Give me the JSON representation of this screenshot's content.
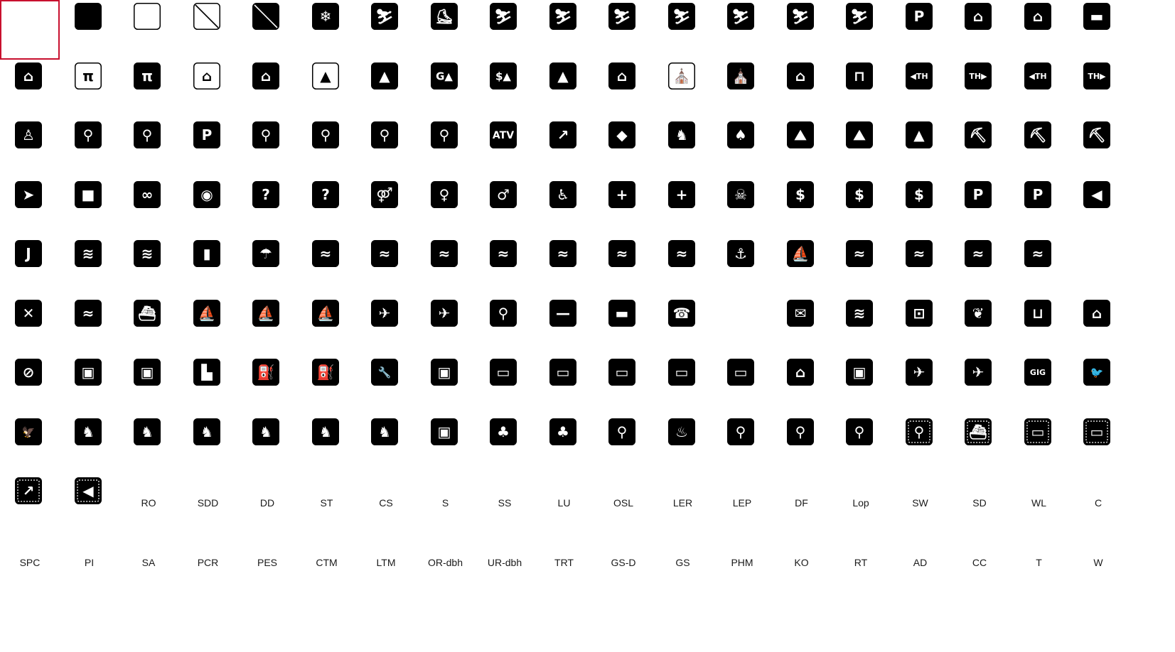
{
  "colors": {
    "symbol": "#000000",
    "symbol_fg": "#ffffff",
    "selection": "#c8102e",
    "label": "#1a1a1a"
  },
  "palette": {
    "columns": 19,
    "selected_index": 0,
    "items": [
      {
        "kind": "blank",
        "icon": "blank-selected"
      },
      {
        "kind": "solid",
        "icon": "solid-black-square"
      },
      {
        "kind": "outline",
        "icon": "outline-square"
      },
      {
        "kind": "slash-outline",
        "icon": "prohibition-outline-square"
      },
      {
        "kind": "slash-solid",
        "icon": "prohibition-solid-square"
      },
      {
        "kind": "glyph",
        "icon": "snowflake-icon",
        "glyph": "❄"
      },
      {
        "kind": "glyph",
        "icon": "snowshoeing-icon",
        "glyph": "⛷"
      },
      {
        "kind": "glyph",
        "icon": "ice-skating-icon",
        "glyph": "⛸"
      },
      {
        "kind": "glyph",
        "icon": "cross-country-ski-icon",
        "glyph": "⛷"
      },
      {
        "kind": "glyph",
        "icon": "snowmobile-icon",
        "glyph": "⛷"
      },
      {
        "kind": "glyph",
        "icon": "downhill-ski-icon",
        "glyph": "⛷"
      },
      {
        "kind": "glyph",
        "icon": "ski-jump-icon",
        "glyph": "⛷"
      },
      {
        "kind": "glyph",
        "icon": "sledding-icon",
        "glyph": "⛷"
      },
      {
        "kind": "glyph",
        "icon": "tobogganing-icon",
        "glyph": "⛷"
      },
      {
        "kind": "glyph",
        "icon": "snowmobile-trail-icon",
        "glyph": "⛷"
      },
      {
        "kind": "glyph",
        "icon": "snowmobile-parking-icon",
        "glyph": "P"
      },
      {
        "kind": "glyph",
        "icon": "shelter-icon",
        "glyph": "⌂"
      },
      {
        "kind": "glyph",
        "icon": "lodge-icon",
        "glyph": "⌂"
      },
      {
        "kind": "glyph",
        "icon": "bed-icon",
        "glyph": "▬"
      },
      {
        "kind": "glyph",
        "icon": "picnic-shelter-icon",
        "glyph": "⌂"
      },
      {
        "kind": "glyph-outline",
        "icon": "picnic-table-outline-icon",
        "glyph": "π"
      },
      {
        "kind": "glyph",
        "icon": "picnic-table-icon",
        "glyph": "π"
      },
      {
        "kind": "glyph-outline",
        "icon": "trailer-site-outline-icon",
        "glyph": "⌂"
      },
      {
        "kind": "glyph",
        "icon": "trailer-site-icon",
        "glyph": "⌂"
      },
      {
        "kind": "glyph-outline",
        "icon": "campground-outline-icon",
        "glyph": "▲"
      },
      {
        "kind": "glyph",
        "icon": "campground-icon",
        "glyph": "▲"
      },
      {
        "kind": "glyph",
        "icon": "group-camping-icon",
        "glyph": "G▲"
      },
      {
        "kind": "glyph",
        "icon": "paid-camping-icon",
        "glyph": "$▲"
      },
      {
        "kind": "glyph",
        "icon": "tent-icon",
        "glyph": "▲"
      },
      {
        "kind": "glyph",
        "icon": "cabin-icon",
        "glyph": "⌂"
      },
      {
        "kind": "glyph-outline",
        "icon": "chapel-outline-icon",
        "glyph": "⛪"
      },
      {
        "kind": "glyph",
        "icon": "chapel-icon",
        "glyph": "⛪"
      },
      {
        "kind": "glyph",
        "icon": "ranger-station-icon",
        "glyph": "⌂"
      },
      {
        "kind": "glyph",
        "icon": "lookout-tower-icon",
        "glyph": "⊓"
      },
      {
        "kind": "glyph",
        "icon": "trailhead-left-icon",
        "glyph": "◀TH"
      },
      {
        "kind": "glyph",
        "icon": "trailhead-right-icon",
        "glyph": "TH▶"
      },
      {
        "kind": "glyph",
        "icon": "trailhead-left-bold-icon",
        "glyph": "◀TH"
      },
      {
        "kind": "glyph",
        "icon": "trailhead-right-bold-icon",
        "glyph": "TH▶"
      },
      {
        "kind": "glyph",
        "icon": "hiking-icon",
        "glyph": "♙"
      },
      {
        "kind": "glyph",
        "icon": "bicycle-icon",
        "glyph": "⚲"
      },
      {
        "kind": "glyph",
        "icon": "mountain-bike-icon",
        "glyph": "⚲"
      },
      {
        "kind": "glyph",
        "icon": "motorbike-parking-icon",
        "glyph": "P"
      },
      {
        "kind": "glyph",
        "icon": "motorbike-icon",
        "glyph": "⚲"
      },
      {
        "kind": "glyph",
        "icon": "atv-icon",
        "glyph": "⚲"
      },
      {
        "kind": "glyph",
        "icon": "atv-rider-icon",
        "glyph": "⚲"
      },
      {
        "kind": "glyph",
        "icon": "atv-vehicle-icon",
        "glyph": "⚲"
      },
      {
        "kind": "text",
        "icon": "atv-text-icon",
        "glyph": "ATV"
      },
      {
        "kind": "glyph",
        "icon": "point-of-interest-icon",
        "glyph": "↗"
      },
      {
        "kind": "glyph",
        "icon": "bear-icon",
        "glyph": "◆"
      },
      {
        "kind": "glyph",
        "icon": "deer-icon",
        "glyph": "♞"
      },
      {
        "kind": "glyph",
        "icon": "squirrel-icon",
        "glyph": "♠"
      },
      {
        "kind": "glyph",
        "icon": "rock-climbing-icon",
        "glyph": "⛰"
      },
      {
        "kind": "glyph",
        "icon": "climbing-icon",
        "glyph": "⛰"
      },
      {
        "kind": "glyph",
        "icon": "rock-collecting-icon",
        "glyph": "▲"
      },
      {
        "kind": "glyph",
        "icon": "mine-cart-icon",
        "glyph": "⛏"
      },
      {
        "kind": "glyph",
        "icon": "pickaxe-icon",
        "glyph": "⛏"
      },
      {
        "kind": "glyph",
        "icon": "crawling-icon",
        "glyph": "⛏"
      },
      {
        "kind": "glyph",
        "icon": "fish-arrow-icon",
        "glyph": "➤"
      },
      {
        "kind": "glyph",
        "icon": "square-target-icon",
        "glyph": "■"
      },
      {
        "kind": "glyph",
        "icon": "binoculars-icon",
        "glyph": "∞"
      },
      {
        "kind": "glyph",
        "icon": "camera-icon",
        "glyph": "◉"
      },
      {
        "kind": "glyph",
        "icon": "information-icon",
        "glyph": "?"
      },
      {
        "kind": "glyph",
        "icon": "info-house-icon",
        "glyph": "?"
      },
      {
        "kind": "glyph",
        "icon": "restrooms-icon",
        "glyph": "⚤"
      },
      {
        "kind": "glyph",
        "icon": "women-restroom-icon",
        "glyph": "♀"
      },
      {
        "kind": "glyph",
        "icon": "men-restroom-icon",
        "glyph": "♂"
      },
      {
        "kind": "glyph",
        "icon": "wheelchair-icon",
        "glyph": "♿"
      },
      {
        "kind": "glyph",
        "icon": "first-aid-icon",
        "glyph": "+"
      },
      {
        "kind": "glyph",
        "icon": "first-aid-box-icon",
        "glyph": "+"
      },
      {
        "kind": "glyph",
        "icon": "skull-crossbones-icon",
        "glyph": "☠"
      },
      {
        "kind": "glyph",
        "icon": "dollar-icon",
        "glyph": "$"
      },
      {
        "kind": "glyph",
        "icon": "dollar-bold-icon",
        "glyph": "$"
      },
      {
        "kind": "glyph",
        "icon": "dollar-house-icon",
        "glyph": "$"
      },
      {
        "kind": "glyph",
        "icon": "parking-icon",
        "glyph": "P"
      },
      {
        "kind": "glyph",
        "icon": "parking-serif-icon",
        "glyph": "P"
      },
      {
        "kind": "glyph",
        "icon": "fish-icon",
        "glyph": "◀"
      },
      {
        "kind": "glyph",
        "icon": "fishing-hook-icon",
        "glyph": "J"
      },
      {
        "kind": "glyph",
        "icon": "waves-icon",
        "glyph": "≋"
      },
      {
        "kind": "glyph",
        "icon": "dam-icon",
        "glyph": "≋"
      },
      {
        "kind": "glyph",
        "icon": "lighthouse-icon",
        "glyph": "▮"
      },
      {
        "kind": "glyph",
        "icon": "shower-icon",
        "glyph": "☂"
      },
      {
        "kind": "glyph",
        "icon": "wading-icon",
        "glyph": "≈"
      },
      {
        "kind": "glyph",
        "icon": "swimming-icon",
        "glyph": "≈"
      },
      {
        "kind": "glyph",
        "icon": "beach-icon",
        "glyph": "≈"
      },
      {
        "kind": "glyph",
        "icon": "diving-icon",
        "glyph": "≈"
      },
      {
        "kind": "glyph",
        "icon": "surfing-icon",
        "glyph": "≈"
      },
      {
        "kind": "glyph",
        "icon": "scuba-icon",
        "glyph": "≈"
      },
      {
        "kind": "glyph",
        "icon": "snorkel-icon",
        "glyph": "≈"
      },
      {
        "kind": "glyph",
        "icon": "anchor-icon",
        "glyph": "⚓"
      },
      {
        "kind": "glyph",
        "icon": "boat-launch-icon",
        "glyph": "⛵"
      },
      {
        "kind": "glyph",
        "icon": "rafting-icon",
        "glyph": "≈"
      },
      {
        "kind": "glyph",
        "icon": "rowing-icon",
        "glyph": "≈"
      },
      {
        "kind": "glyph",
        "icon": "canoe-icon",
        "glyph": "≈"
      },
      {
        "kind": "glyph",
        "icon": "kayak-icon",
        "glyph": "≈"
      },
      {
        "kind": "none",
        "icon": "empty-slot"
      },
      {
        "kind": "glyph",
        "icon": "paddle-icon",
        "glyph": "✕"
      },
      {
        "kind": "glyph",
        "icon": "water-ski-icon",
        "glyph": "≈"
      },
      {
        "kind": "glyph",
        "icon": "motorboat-icon",
        "glyph": "⛴"
      },
      {
        "kind": "glyph",
        "icon": "sailboat-icon",
        "glyph": "⛵"
      },
      {
        "kind": "glyph",
        "icon": "windsurf-icon",
        "glyph": "⛵"
      },
      {
        "kind": "glyph",
        "icon": "sailing-icon",
        "glyph": "⛵"
      },
      {
        "kind": "glyph",
        "icon": "hang-glider-icon",
        "glyph": "✈"
      },
      {
        "kind": "glyph",
        "icon": "paper-plane-icon",
        "glyph": "✈"
      },
      {
        "kind": "glyph",
        "icon": "hunting-icon",
        "glyph": "⚲"
      },
      {
        "kind": "glyph",
        "icon": "rifle-icon",
        "glyph": "—"
      },
      {
        "kind": "glyph",
        "icon": "smoking-icon",
        "glyph": "▬"
      },
      {
        "kind": "glyph",
        "icon": "telephone-icon",
        "glyph": "☎"
      },
      {
        "kind": "none",
        "icon": "empty-slot"
      },
      {
        "kind": "glyph",
        "icon": "mail-icon",
        "glyph": "✉"
      },
      {
        "kind": "glyph",
        "icon": "water-fountain-icon",
        "glyph": "≋"
      },
      {
        "kind": "glyph",
        "icon": "tv-icon",
        "glyph": "⊡"
      },
      {
        "kind": "glyph",
        "icon": "environment-icon",
        "glyph": "❦"
      },
      {
        "kind": "glyph",
        "icon": "drinking-water-icon",
        "glyph": "⊔"
      },
      {
        "kind": "glyph",
        "icon": "pet-house-icon",
        "glyph": "⌂"
      },
      {
        "kind": "glyph",
        "icon": "restaurant-icon",
        "glyph": "⊘"
      },
      {
        "kind": "glyph",
        "icon": "lodging-icon",
        "glyph": "▣"
      },
      {
        "kind": "glyph",
        "icon": "laundry-icon",
        "glyph": "▣"
      },
      {
        "kind": "glyph",
        "icon": "sanitary-station-icon",
        "glyph": "▙"
      },
      {
        "kind": "glyph",
        "icon": "fuel-icon",
        "glyph": "⛽"
      },
      {
        "kind": "glyph",
        "icon": "diesel-fuel-icon",
        "glyph": "⛽"
      },
      {
        "kind": "glyph",
        "icon": "wrench-icon",
        "glyph": "🔧"
      },
      {
        "kind": "glyph",
        "icon": "trailer-sanitary-icon",
        "glyph": "▣"
      },
      {
        "kind": "glyph",
        "icon": "rv-icon",
        "glyph": "▭"
      },
      {
        "kind": "glyph",
        "icon": "bus-icon",
        "glyph": "▭"
      },
      {
        "kind": "glyph",
        "icon": "truck-icon",
        "glyph": "▭"
      },
      {
        "kind": "glyph",
        "icon": "car-ferry-icon",
        "glyph": "▭"
      },
      {
        "kind": "glyph",
        "icon": "car-icon",
        "glyph": "▭"
      },
      {
        "kind": "glyph",
        "icon": "tunnel-icon",
        "glyph": "⌂"
      },
      {
        "kind": "glyph",
        "icon": "gondola-icon",
        "glyph": "▣"
      },
      {
        "kind": "glyph",
        "icon": "helicopter-icon",
        "glyph": "✈"
      },
      {
        "kind": "glyph",
        "icon": "airport-icon",
        "glyph": "✈"
      },
      {
        "kind": "glyph",
        "icon": "gig-icon",
        "glyph": "GIG"
      },
      {
        "kind": "glyph",
        "icon": "bird-icon",
        "glyph": "🐦"
      },
      {
        "kind": "glyph",
        "icon": "eagle-icon",
        "glyph": "🦅"
      },
      {
        "kind": "glyph",
        "icon": "horseback-riding-icon",
        "glyph": "♞"
      },
      {
        "kind": "glyph",
        "icon": "stable-icon",
        "glyph": "♞"
      },
      {
        "kind": "glyph",
        "icon": "pack-horse-icon",
        "glyph": "♞"
      },
      {
        "kind": "glyph",
        "icon": "horse-icon",
        "glyph": "♞"
      },
      {
        "kind": "glyph",
        "icon": "horse-trail-icon",
        "glyph": "♞"
      },
      {
        "kind": "glyph",
        "icon": "dog-icon",
        "glyph": "♞"
      },
      {
        "kind": "glyph",
        "icon": "litter-icon",
        "glyph": "▣"
      },
      {
        "kind": "glyph",
        "icon": "tree-icon",
        "glyph": "♣"
      },
      {
        "kind": "glyph",
        "icon": "no-tree-icon",
        "glyph": "♣"
      },
      {
        "kind": "glyph",
        "icon": "gardening-icon",
        "glyph": "⚲"
      },
      {
        "kind": "glyph",
        "icon": "campfire-icon",
        "glyph": "♨"
      },
      {
        "kind": "glyph",
        "icon": "walking-icon",
        "glyph": "⚲"
      },
      {
        "kind": "glyph",
        "icon": "walking-path-icon",
        "glyph": "⚲"
      },
      {
        "kind": "glyph",
        "icon": "trash-disposal-icon",
        "glyph": "⚲"
      },
      {
        "kind": "glyph",
        "icon": "dashed-walking-icon",
        "glyph": "⚲"
      },
      {
        "kind": "glyph",
        "icon": "dashed-boat-icon",
        "glyph": "⛴"
      },
      {
        "kind": "glyph",
        "icon": "dashed-car-ferry-icon",
        "glyph": "▭"
      },
      {
        "kind": "glyph",
        "icon": "dashed-car-icon",
        "glyph": "▭"
      },
      {
        "kind": "glyph",
        "icon": "dashed-point-icon",
        "glyph": "↗"
      },
      {
        "kind": "glyph",
        "icon": "dashed-fish-icon",
        "glyph": "◀"
      },
      {
        "kind": "label",
        "text": "RO"
      },
      {
        "kind": "label",
        "text": "SDD"
      },
      {
        "kind": "label",
        "text": "DD"
      },
      {
        "kind": "label",
        "text": "ST"
      },
      {
        "kind": "label",
        "text": "CS"
      },
      {
        "kind": "label",
        "text": "S"
      },
      {
        "kind": "label",
        "text": "SS"
      },
      {
        "kind": "label",
        "text": "LU"
      },
      {
        "kind": "label",
        "text": "OSL"
      },
      {
        "kind": "label",
        "text": "LER"
      },
      {
        "kind": "label",
        "text": "LEP"
      },
      {
        "kind": "label",
        "text": "DF"
      },
      {
        "kind": "label",
        "text": "Lop"
      },
      {
        "kind": "label",
        "text": "SW"
      },
      {
        "kind": "label",
        "text": "SD"
      },
      {
        "kind": "label",
        "text": "WL"
      },
      {
        "kind": "label",
        "text": "C"
      },
      {
        "kind": "label",
        "text": "SPC"
      },
      {
        "kind": "label",
        "text": "PI"
      },
      {
        "kind": "label",
        "text": "SA"
      },
      {
        "kind": "label",
        "text": "PCR"
      },
      {
        "kind": "label",
        "text": "PES"
      },
      {
        "kind": "label",
        "text": "CTM"
      },
      {
        "kind": "label",
        "text": "LTM"
      },
      {
        "kind": "label",
        "text": "OR-dbh"
      },
      {
        "kind": "label",
        "text": "UR-dbh"
      },
      {
        "kind": "label",
        "text": "TRT"
      },
      {
        "kind": "label",
        "text": "GS-D"
      },
      {
        "kind": "label",
        "text": "GS"
      },
      {
        "kind": "label",
        "text": "PHM"
      },
      {
        "kind": "label",
        "text": "KO"
      },
      {
        "kind": "label",
        "text": "RT"
      },
      {
        "kind": "label",
        "text": "AD"
      },
      {
        "kind": "label",
        "text": "CC"
      },
      {
        "kind": "label",
        "text": "T"
      },
      {
        "kind": "label",
        "text": "W"
      }
    ]
  }
}
